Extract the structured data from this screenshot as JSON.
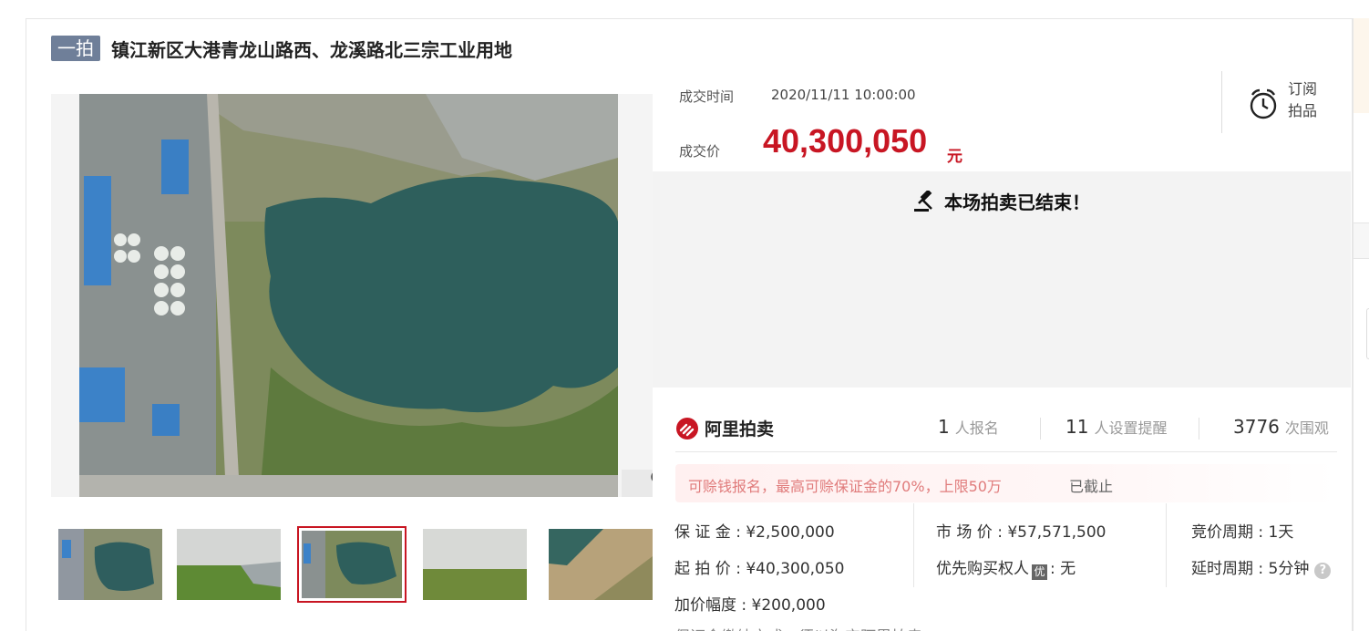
{
  "header": {
    "badge": "一拍",
    "title": "镇江新区大港青龙山路西、龙溪路北三宗工业用地"
  },
  "deal": {
    "time_label": "成交时间",
    "time_value": "2020/11/11 10:00:00",
    "price_label": "成交价",
    "price_value": "40,300,050",
    "price_unit": "元"
  },
  "subscribe": {
    "icon": "alarm-clock-icon",
    "line1": "订阅",
    "line2": "拍品"
  },
  "status": {
    "icon": "gavel-icon",
    "text": "本场拍卖已结束！"
  },
  "brand": {
    "name": "阿里拍卖",
    "color": "#c81623"
  },
  "stats": {
    "signup_count": "1",
    "signup_label": "人报名",
    "remind_count": "11",
    "remind_label": "人设置提醒",
    "view_count": "3776",
    "view_label": "次围观"
  },
  "notice": {
    "text": "可赊钱报名，最高可赊保证金的70%，上限50万",
    "status": "已截止"
  },
  "details": {
    "deposit": "保 证 金 : ¥2,500,000",
    "market_price": "市 场 价 : ¥57,571,500",
    "bid_period": "竞价周期 : 1天",
    "start_price": "起 拍 价 : ¥40,300,050",
    "priority_label": "优先购买权人",
    "priority_icon": "优",
    "priority_value": ": 无",
    "delay_period": "延时周期 : 5分钟",
    "help_icon": "?",
    "increment": "加价幅度 : ¥200,000",
    "cutoff_text": "保证金缴纳方式：须以淘宝阿里拍卖"
  },
  "colors": {
    "accent": "#c81623",
    "badge_bg": "#6f7f99"
  }
}
